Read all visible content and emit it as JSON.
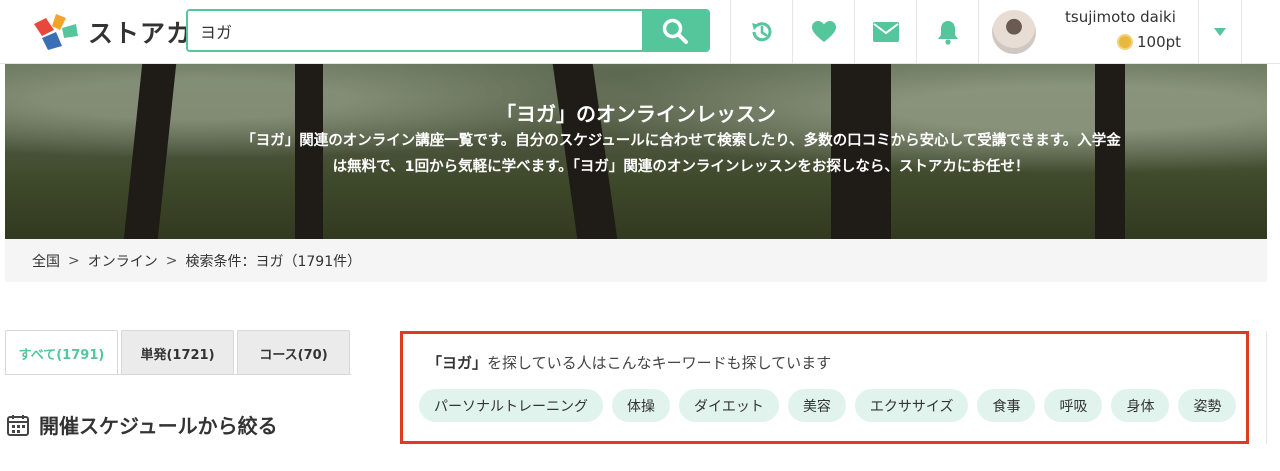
{
  "header": {
    "logo_text": "ストアカ",
    "search_value": "ヨガ",
    "icons": [
      "history-icon",
      "heart-icon",
      "mail-icon",
      "bell-icon"
    ],
    "user": {
      "name": "tsujimoto daiki",
      "points": "100pt"
    },
    "colors": {
      "accent": "#55c59c"
    }
  },
  "hero": {
    "title": "「ヨガ」のオンラインレッスン",
    "description": "「ヨガ」関連のオンライン講座一覧です。自分のスケジュールに合わせて検索したり、多数の口コミから安心して受講できます。入学金は無料で、1回から気軽に学べます。「ヨガ」関連のオンラインレッスンをお探しなら、ストアカにお任せ！"
  },
  "breadcrumb": {
    "items": [
      "全国",
      "オンライン",
      "検索条件：ヨガ（1791件）"
    ],
    "separator": ">"
  },
  "tabs": [
    {
      "label": "すべて(1791)",
      "active": true
    },
    {
      "label": "単発(1721)",
      "active": false
    },
    {
      "label": "コース(70)",
      "active": false
    }
  ],
  "schedule_heading": "開催スケジュールから絞る",
  "keywords": {
    "heading_bold": "「ヨガ」",
    "heading_rest": "を探している人はこんなキーワードも探しています",
    "tags": [
      "パーソナルトレーニング",
      "体操",
      "ダイエット",
      "美容",
      "エクササイズ",
      "食事",
      "呼吸",
      "身体",
      "姿勢"
    ],
    "border_color": "#e03a22"
  }
}
